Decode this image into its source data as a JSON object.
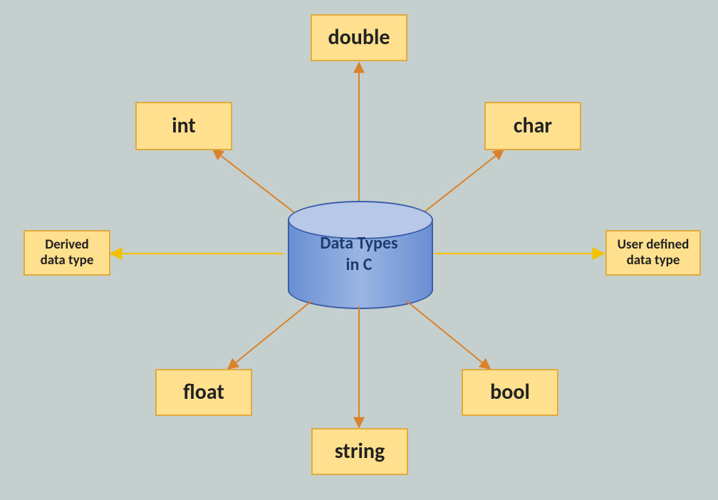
{
  "center": {
    "label": "Data Types\nin C"
  },
  "nodes": {
    "double": {
      "label": "double"
    },
    "int": {
      "label": "int"
    },
    "char": {
      "label": "char"
    },
    "derived": {
      "label": "Derived\ndata type"
    },
    "user": {
      "label": "User defined\ndata type"
    },
    "float": {
      "label": "float"
    },
    "bool": {
      "label": "bool"
    },
    "string": {
      "label": "string"
    }
  },
  "colors": {
    "box_fill": "#ffe08f",
    "box_border": "#e0aa3e",
    "arrow_orange": "#d9822b",
    "arrow_yellow": "#f2c200",
    "cylinder_fill": "#9bb5e2",
    "cylinder_border": "#3a5ea8",
    "background": "#c5cfce"
  }
}
